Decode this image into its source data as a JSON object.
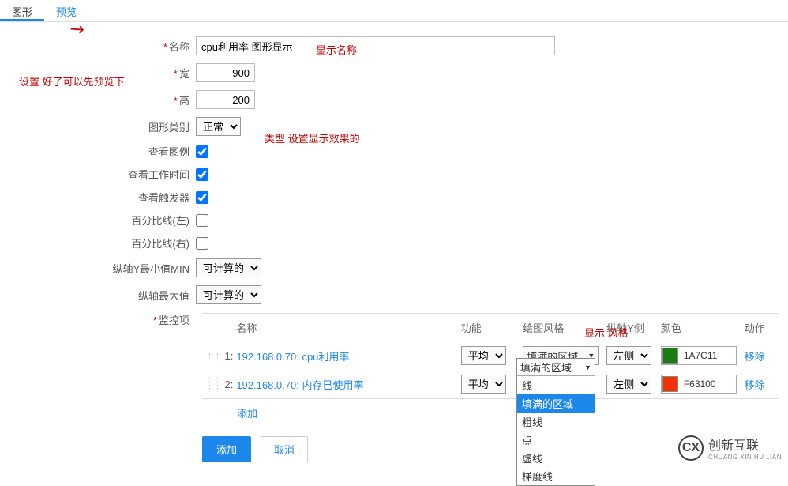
{
  "tabs": {
    "graphic": "图形",
    "preview": "预览"
  },
  "annotations": {
    "preview_hint": "设置 好了可以先预览下",
    "name_hint": "显示名称",
    "type_hint": "类型 设置显示效果的",
    "style_hint": "显示 风格"
  },
  "form": {
    "name_label": "名称",
    "name_value": "cpu利用率 图形显示",
    "width_label": "宽",
    "width_value": "900",
    "height_label": "高",
    "height_value": "200",
    "type_label": "图形类别",
    "type_value": "正常",
    "legend_label": "查看图例",
    "worktime_label": "查看工作时间",
    "trigger_label": "查看触发器",
    "pct_left_label": "百分比线(左)",
    "pct_right_label": "百分比线(右)",
    "ymin_label": "纵轴Y最小值MIN",
    "ymin_value": "可计算的",
    "ymax_label": "纵轴最大值",
    "ymax_value": "可计算的",
    "monitor_label": "监控项"
  },
  "table": {
    "headers": {
      "name": "名称",
      "func": "功能",
      "style": "绘图风格",
      "yside": "纵轴Y侧",
      "color": "颜色",
      "action": "动作"
    },
    "rows": [
      {
        "idx": "1:",
        "name": "192.168.0.70: cpu利用率",
        "func": "平均",
        "style": "填满的区域",
        "yside": "左侧",
        "color": "1A7C11",
        "action": "移除"
      },
      {
        "idx": "2:",
        "name": "192.168.0.70: 内存已使用率",
        "func": "平均",
        "style": "",
        "yside": "左侧",
        "color": "F63100",
        "action": "移除"
      }
    ],
    "add_row": "添加"
  },
  "dropdown": {
    "current": "填满的区域",
    "options": [
      "线",
      "填满的区域",
      "粗线",
      "点",
      "虚线",
      "梯度线"
    ]
  },
  "buttons": {
    "add": "添加",
    "cancel": "取消"
  },
  "logo": {
    "cn": "创新互联",
    "en": "CHUANG XIN HU LIAN",
    "mark": "CX"
  }
}
